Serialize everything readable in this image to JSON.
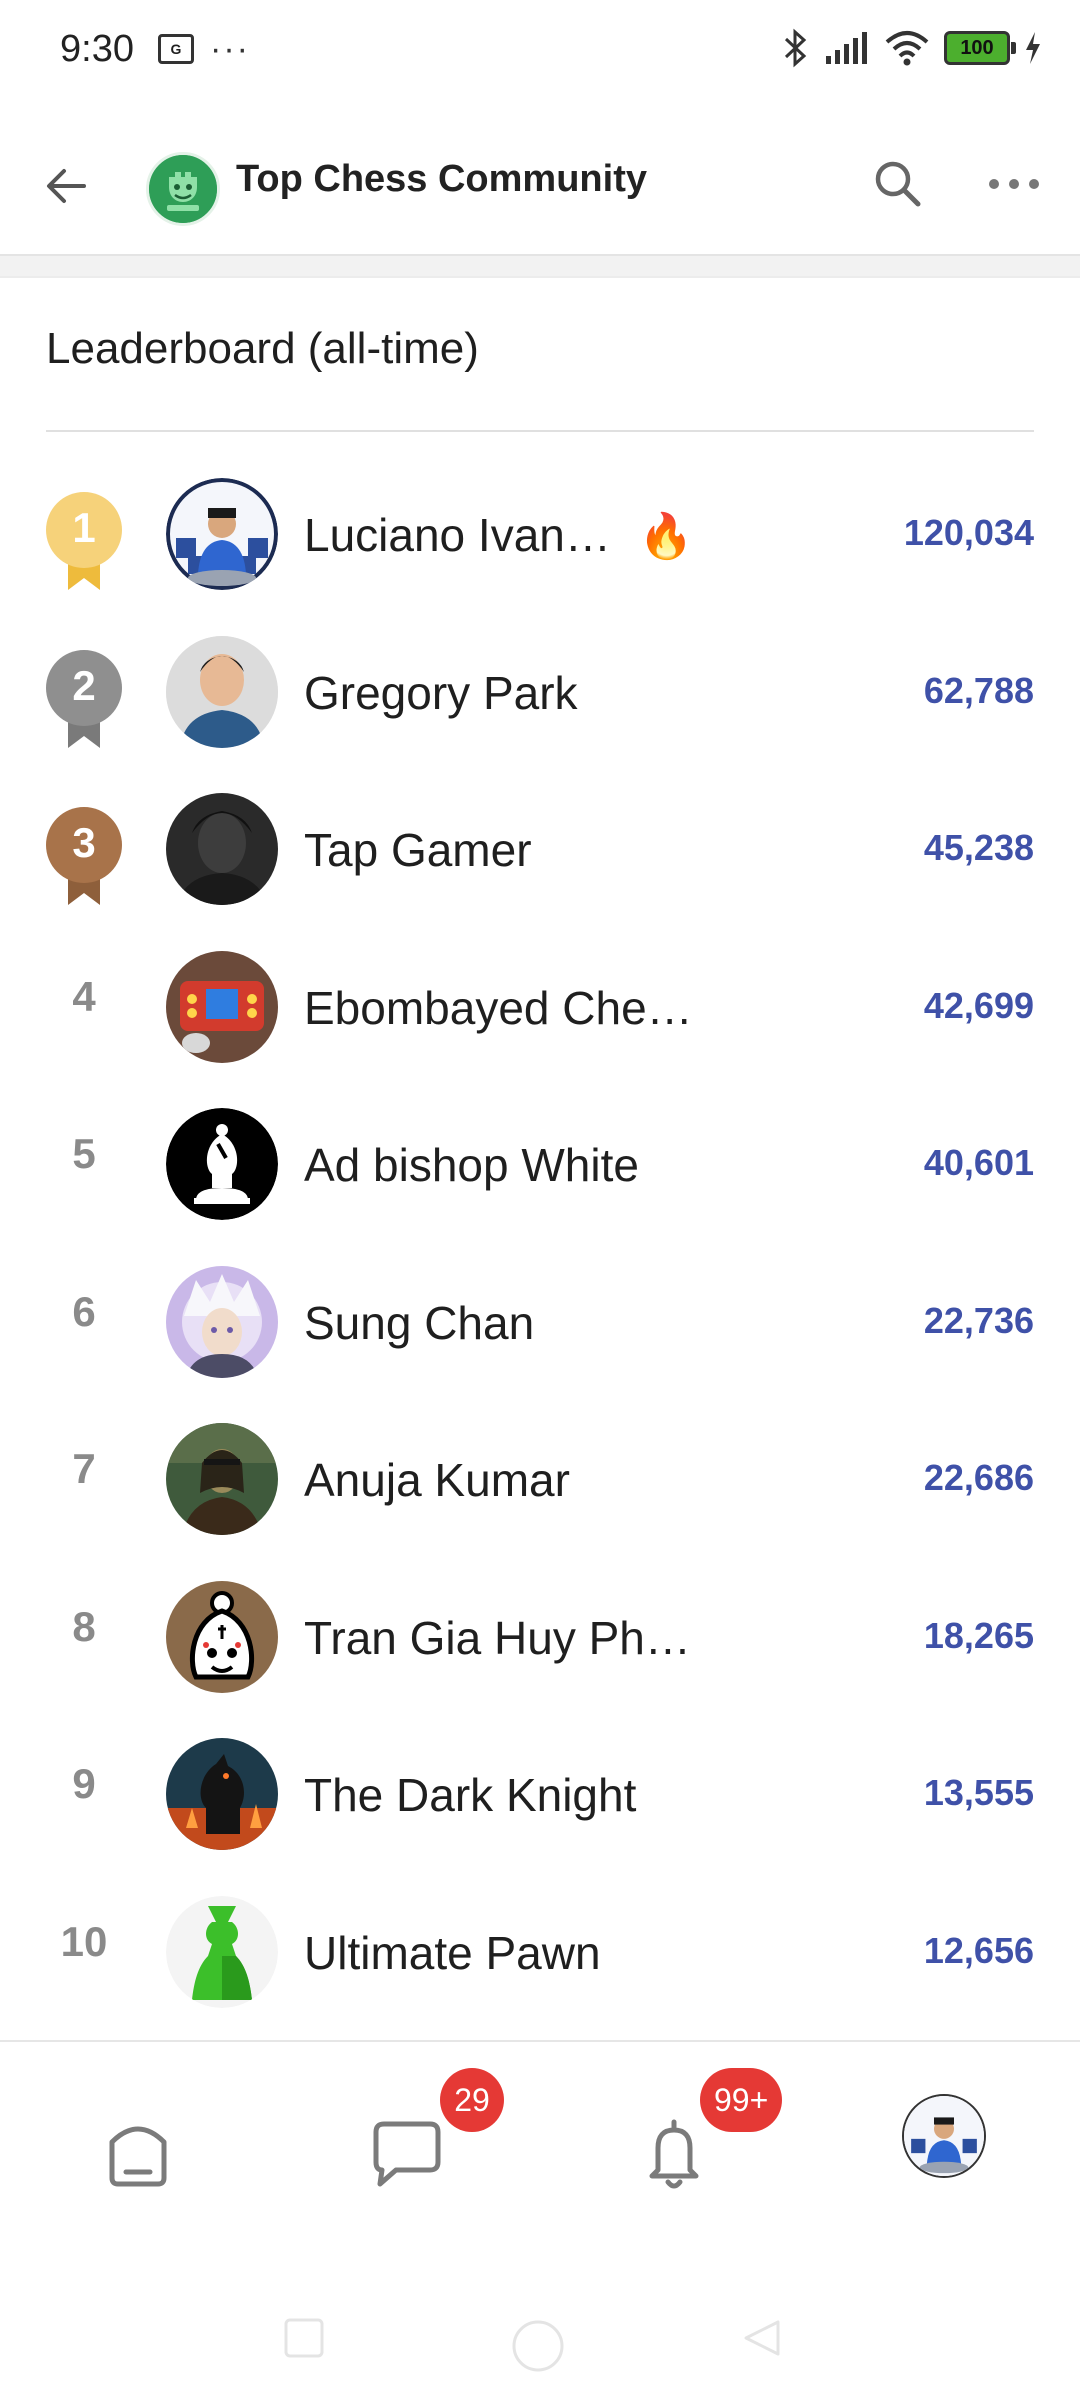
{
  "status_bar": {
    "time": "9:30",
    "sim_label": "G",
    "more": "···",
    "battery": "100"
  },
  "app_bar": {
    "title": "Top Chess Community"
  },
  "leaderboard": {
    "heading": "Leaderboard (all-time)",
    "entries": [
      {
        "rank": "1",
        "name": "Luciano Ivan…",
        "score": "120,034",
        "badge": "🔥",
        "medal": "gold"
      },
      {
        "rank": "2",
        "name": "Gregory Park",
        "score": "62,788",
        "medal": "silver"
      },
      {
        "rank": "3",
        "name": "Tap Gamer",
        "score": "45,238",
        "medal": "bronze"
      },
      {
        "rank": "4",
        "name": "Ebombayed Che…",
        "score": "42,699"
      },
      {
        "rank": "5",
        "name": "Ad bishop White",
        "score": "40,601"
      },
      {
        "rank": "6",
        "name": "Sung Chan",
        "score": "22,736"
      },
      {
        "rank": "7",
        "name": "Anuja Kumar",
        "score": "22,686"
      },
      {
        "rank": "8",
        "name": "Tran Gia Huy Ph…",
        "score": "18,265"
      },
      {
        "rank": "9",
        "name": "The Dark Knight",
        "score": "13,555"
      },
      {
        "rank": "10",
        "name": "Ultimate Pawn",
        "score": "12,656"
      }
    ]
  },
  "bottom_nav": {
    "chats_badge": "29",
    "notifications_badge": "99+"
  },
  "colors": {
    "gold": "#f6d27a",
    "silver": "#8f8f8f",
    "bronze": "#a8734a",
    "score": "#3f51a8",
    "badge": "#e53935"
  }
}
